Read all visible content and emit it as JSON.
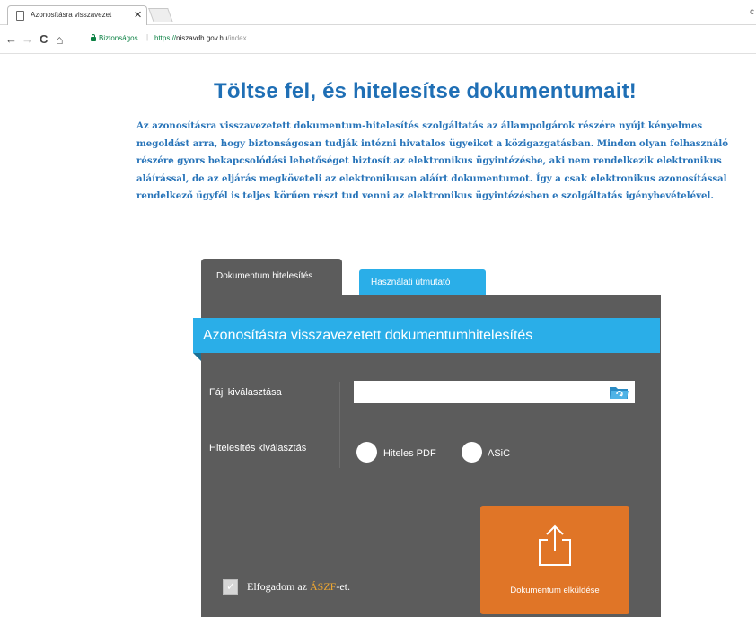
{
  "browser": {
    "tab_title": "Azonosításra visszavezet",
    "tab_close": "✕",
    "back": "←",
    "forward": "→",
    "reload": "C",
    "home": "⌂",
    "security_label": "Biztonságos",
    "url_scheme": "https://",
    "url_host": "niszavdh.gov.hu",
    "url_path": "/index",
    "corner": "c"
  },
  "page": {
    "headline": "Töltse fel, és hitelesítse dokumentumait!",
    "intro": "Az azonosításra visszavezetett dokumentum-hitelesítés szolgáltatás az állampolgárok részére nyújt kényelmes megoldást arra, hogy biztonságosan tudják intézni hivatalos ügyeiket a közigazgatásban. Minden olyan felhasználó részére gyors bekapcsolódási lehetőséget biztosít az elektronikus ügyintézésbe, aki nem rendelkezik elektronikus aláírással, de az eljárás megköveteli az elektronikusan aláírt dokumentumot. Így a csak elektronikus azonosítással rendelkező ügyfél is teljes körűen részt tud venni az elektronikus ügyintézésben e szolgáltatás igénybevételével."
  },
  "tabs": {
    "document": "Dokumentum hitelesítés",
    "help": "Használati útmutató"
  },
  "form": {
    "banner": "Azonosításra visszavezetett dokumentumhitelesítés",
    "file_label": "Fájl kiválasztása",
    "file_value": "",
    "auth_label": "Hitelesítés kiválasztás",
    "option_pdf": "Hiteles PDF",
    "option_asic": "ASiC",
    "submit_label": "Dokumentum elküldése",
    "accept_prefix": "Elfogadom az ",
    "accept_link": "ÁSZF",
    "accept_suffix": "-et.",
    "check_mark": "✓"
  },
  "colors": {
    "headline": "#1f6fb5",
    "panel": "#5c5c5c",
    "accent_blue": "#2aaee8",
    "submit_orange": "#e07527",
    "link_orange": "#f0a830"
  }
}
